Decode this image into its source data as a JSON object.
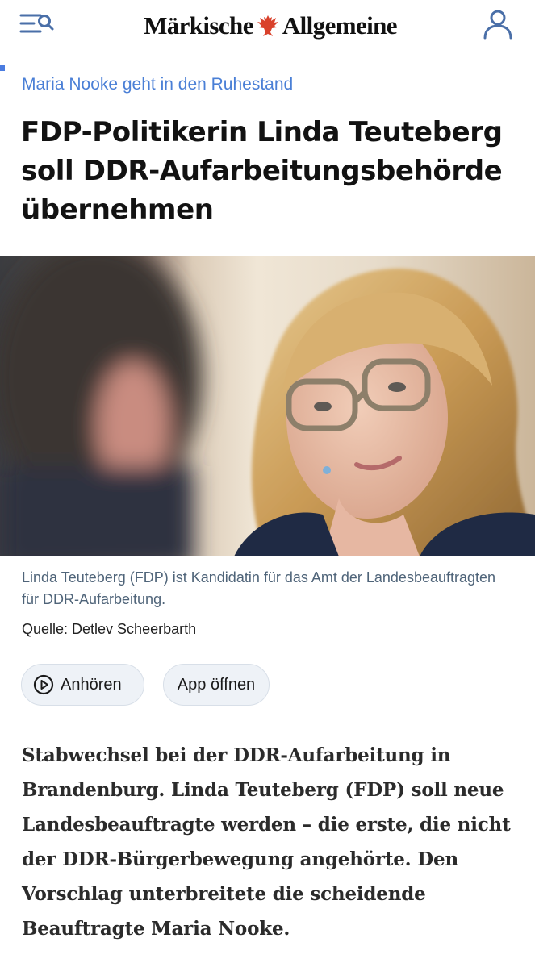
{
  "header": {
    "logo_left": "Märkische",
    "logo_right": "Allgemeine",
    "menu_icon": "menu-search-icon",
    "profile_icon": "user-icon",
    "accent_color": "#4a7ce0",
    "eagle_color": "#d9412b"
  },
  "article": {
    "kicker": "Maria Nooke geht in den Ruhestand",
    "headline": "FDP-Politikerin Linda Teuteberg soll DDR-Aufarbeitungsbehörde übernehmen",
    "image_caption": "Linda Teuteberg (FDP) ist Kandidatin für das Amt der Landesbeauftragten für DDR-Aufarbeitung.",
    "image_source": "Quelle: Detlev Scheerbarth",
    "listen_label": "Anhören",
    "listen_icon": "play-circle-icon",
    "app_label": "App öffnen",
    "lead": "Stabwechsel bei der DDR-Aufarbeitung in Brandenburg. Linda Teuteberg (FDP) soll neue Landesbeauftragte werden – die erste, die nicht der DDR-Bürgerbewegung angehörte. Den Vorschlag unterbreitete die scheidende Beauftragte Maria Nooke."
  }
}
